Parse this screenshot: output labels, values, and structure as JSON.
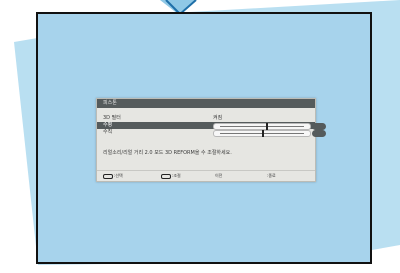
{
  "osd": {
    "title": "피스톤",
    "rows": [
      {
        "label": "3D 필터",
        "value": "켜짐"
      },
      {
        "label": "수평"
      },
      {
        "label": "수직"
      }
    ],
    "note": "리얼소리/리얼 거리 2.0 모드 3D REFORM을 수 조절하세요.",
    "footer": [
      {
        "label": ":선택"
      },
      {
        "label": ":조절"
      },
      {
        "label": "이전"
      },
      {
        "label": ":종료"
      }
    ],
    "slider_levels": [
      0.55,
      0.5
    ]
  },
  "colors": {
    "screen_fill": "#a7d3ec",
    "backdrop": "#b9dff1",
    "osd_bg": "#e6e6e2",
    "osd_header": "#555b5c"
  }
}
